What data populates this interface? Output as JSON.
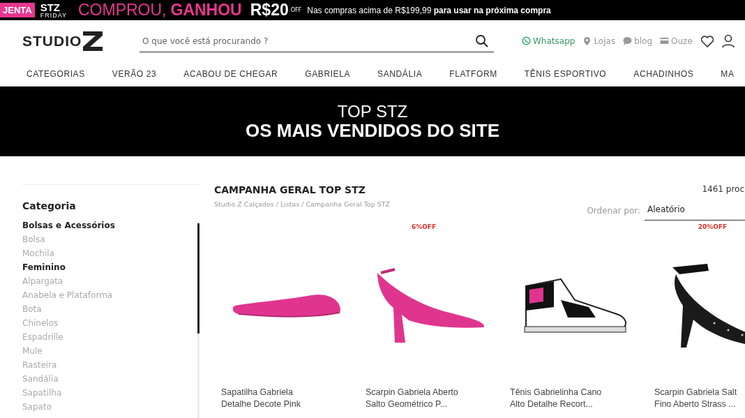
{
  "promo_banner": {
    "tag": "JENTA",
    "brand_top": "STZ",
    "brand_bottom": "FRIDAY",
    "headline_light": "COMPROU,",
    "headline_bold": "GANHOU",
    "amount": "R$20",
    "amount_suffix": "OFF",
    "note": "Nas compras acima de R$199,99 **para usar na próxima compra**"
  },
  "header": {
    "logo": "STUDIO",
    "search": {
      "placeholder": "O que você está procurando ?"
    },
    "links": [
      {
        "kind": "whatsapp",
        "label": "Whatsapp"
      },
      {
        "kind": "pin",
        "label": "Lojas"
      },
      {
        "kind": "chat",
        "label": "blog"
      },
      {
        "kind": "card",
        "label": "Ouze"
      }
    ]
  },
  "nav": [
    "CATEGORIAS",
    "VERÃO 23",
    "ACABOU DE CHEGAR",
    "GABRIELA",
    "SANDÁLIA",
    "FLATFORM",
    "TÊNIS ESPORTIVO",
    "ACHADINHOS",
    "MA"
  ],
  "hero": {
    "subtitle": "TOP STZ",
    "title": "OS MAIS VENDIDOS DO SITE"
  },
  "sidebar": {
    "title": "Categoria",
    "items": [
      {
        "label": "Bolsas e Acessórios",
        "kind": "group"
      },
      {
        "label": "Bolsa",
        "kind": "item"
      },
      {
        "label": "Mochila",
        "kind": "item"
      },
      {
        "label": "Feminino",
        "kind": "group"
      },
      {
        "label": "Alpargata",
        "kind": "item"
      },
      {
        "label": "Anabela e Plataforma",
        "kind": "item"
      },
      {
        "label": "Bota",
        "kind": "item"
      },
      {
        "label": "Chinelos",
        "kind": "item"
      },
      {
        "label": "Espadrille",
        "kind": "item"
      },
      {
        "label": "Mule",
        "kind": "item"
      },
      {
        "label": "Rasteira",
        "kind": "item"
      },
      {
        "label": "Sandália",
        "kind": "item"
      },
      {
        "label": "Sapatilha",
        "kind": "item"
      },
      {
        "label": "Sapato",
        "kind": "item"
      }
    ]
  },
  "listing": {
    "title": "CAMPANHA GERAL TOP STZ",
    "breadcrumb": "Studio Z Calçados / Listas / Campanha Geral Top STZ",
    "count": "1461 proc",
    "sort_label": "Ordenar por:",
    "sort_value": "Aleatório",
    "products": [
      {
        "kind": "flat",
        "name": "Sapatilha Gabriela\nDetalhe Decote Pink"
      },
      {
        "kind": "slingback",
        "badge": "6%OFF",
        "name": "Scarpin Gabriela Aberto\nSalto Geométrico P..."
      },
      {
        "kind": "sneaker",
        "name": "Tênis Gabrielinha Cano\nAlto Detalhe Recort..."
      },
      {
        "kind": "heel",
        "badge": "20%OFF",
        "name": "Scarpin Gabriela Salt\nFino Aberto Strass ..."
      }
    ]
  }
}
